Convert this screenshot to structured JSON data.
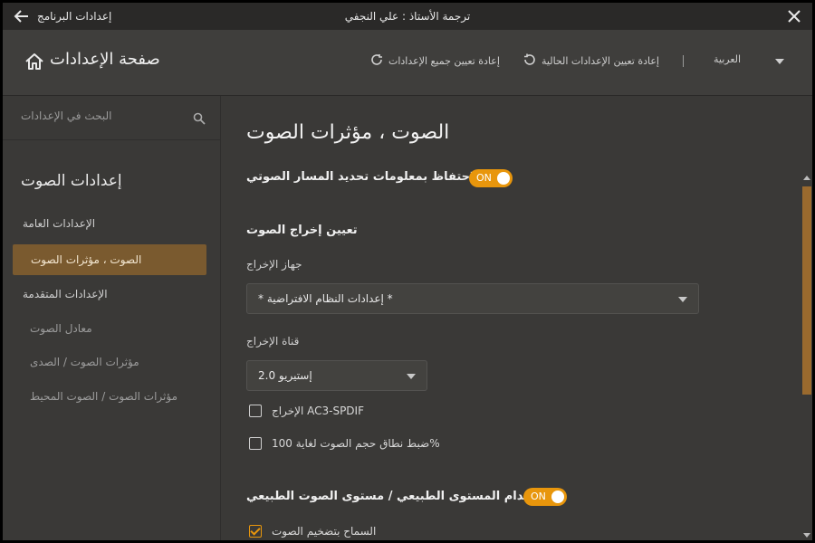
{
  "window": {
    "title": "ترجمة الأستاذ : علي النجفي",
    "app_title": "إعدادات البرنامج"
  },
  "header": {
    "home_title": "صفحة الإعدادات",
    "reset_all": "إعادة تعيين جميع الإعدادات",
    "reset_current": "إعادة تعيين الإعدادات الحالية",
    "language": "العربية"
  },
  "sidebar": {
    "search_placeholder": "البحث في الإعدادات",
    "section_title": "إعدادات الصوت",
    "items": [
      {
        "label": "الإعدادات العامة"
      },
      {
        "label": "الصوت ، مؤثرات الصوت"
      },
      {
        "label": "الإعدادات المتقدمة"
      },
      {
        "label": "معادل الصوت"
      },
      {
        "label": "مؤثرات الصوت / الصدى"
      },
      {
        "label": "مؤثرات الصوت / الصوت المحيط"
      }
    ]
  },
  "main": {
    "page_title": "الصوت ، مؤثرات الصوت",
    "keep_track_info": {
      "label": "الإحتفاظ بمعلومات تحديد المسار الصوتي",
      "toggle": "ON"
    },
    "output_section": "تعيين إخراج الصوت",
    "output_device": {
      "label": "جهاز الإخراج",
      "value": "* إعدادات النظام الافتراضية *"
    },
    "output_channel": {
      "label": "قناة الإخراج",
      "value": "2.0 إستيريو"
    },
    "ac3_spdif": {
      "label": "الإخراج AC3-SPDIF",
      "checked": false
    },
    "volume_range": {
      "label": "ضبط نطاق حجم الصوت لغاية 100%",
      "checked": false
    },
    "normal_level": {
      "label": "إستخدام المستوى الطبيعي / مستوى الصوت الطبيعي",
      "toggle": "ON"
    },
    "allow_amplify": {
      "label": "السماح بتضخيم الصوت",
      "checked": true
    }
  },
  "colors": {
    "accent": "#e8960c",
    "active_nav": "#7a5a2f",
    "background": "#3a3937"
  }
}
